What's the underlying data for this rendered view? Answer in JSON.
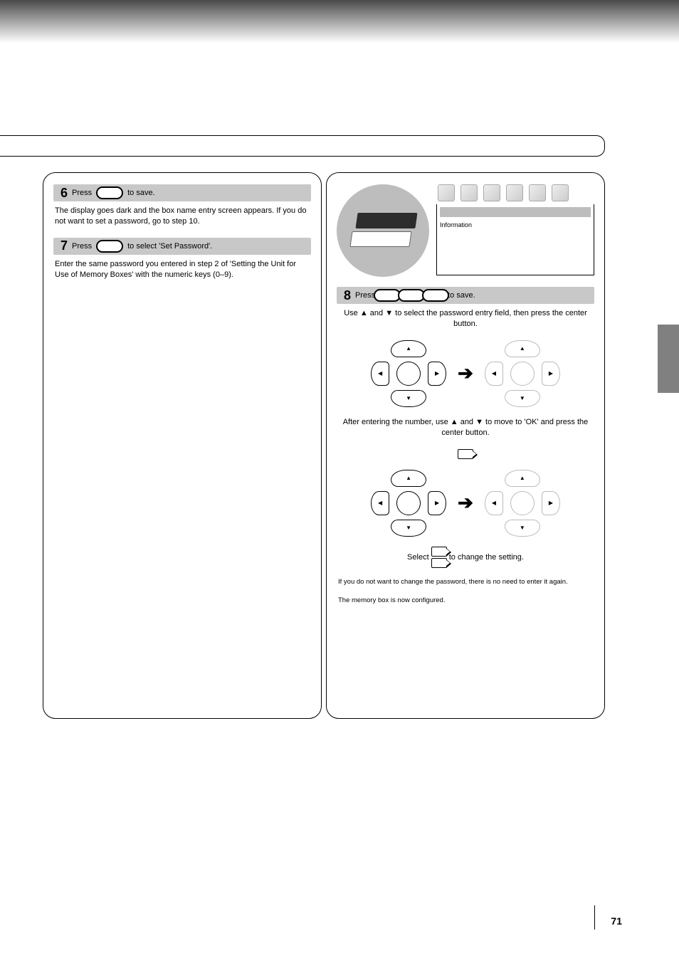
{
  "header": {
    "title": ""
  },
  "left": {
    "steps": [
      {
        "num": "6",
        "label_before": "Press",
        "label_after": "to save.",
        "body": "The display goes dark and the box name entry screen appears. If you do not want to set a password, go to step 10."
      },
      {
        "num": "7",
        "label_before": "Press",
        "label_after": "to select 'Set Password'.",
        "body": "Enter the same password you entered in step 2 of 'Setting the Unit for Use of Memory Boxes' with the numeric keys (0–9)."
      }
    ]
  },
  "info": {
    "label": "Information",
    "sub": ""
  },
  "right": {
    "step8": {
      "num": "8",
      "label_before": "Press",
      "label_after": "to save.",
      "line1": "Use ▲ and ▼ to select the password entry field, then press the center button.",
      "line2": "After entering the number, use ▲ and ▼ to move to 'OK' and press the center button.",
      "note_icon": "tag",
      "note": "",
      "line3_prefix": "Select",
      "line3_icons": "double-tag",
      "line3_suffix": "to change the setting.",
      "line4": "If you do not want to change the password, there is no need to enter it again.",
      "line5": "The memory box is now configured."
    }
  },
  "page_number": "71"
}
